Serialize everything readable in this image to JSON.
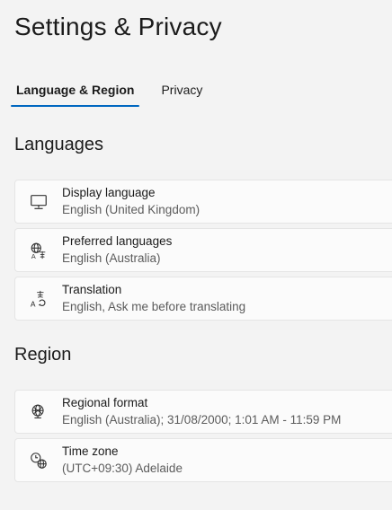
{
  "header": {
    "title": "Settings & Privacy"
  },
  "tabs": [
    {
      "label": "Language & Region",
      "active": true
    },
    {
      "label": "Privacy",
      "active": false
    }
  ],
  "languages": {
    "title": "Languages",
    "items": [
      {
        "icon": "monitor-icon",
        "label": "Display language",
        "value": "English (United Kingdom)"
      },
      {
        "icon": "language-globe-icon",
        "label": "Preferred languages",
        "value": "English (Australia)"
      },
      {
        "icon": "translation-icon",
        "label": "Translation",
        "value": "English, Ask me before translating"
      }
    ]
  },
  "region": {
    "title": "Region",
    "items": [
      {
        "icon": "regional-format-icon",
        "label": "Regional format",
        "value": "English (Australia); 31/08/2000; 1:01 AM - 11:59 PM"
      },
      {
        "icon": "time-zone-icon",
        "label": "Time zone",
        "value": "(UTC+09:30) Adelaide"
      }
    ]
  },
  "colors": {
    "accent": "#0067c0",
    "background": "#f3f3f3",
    "card": "#fbfbfb"
  }
}
